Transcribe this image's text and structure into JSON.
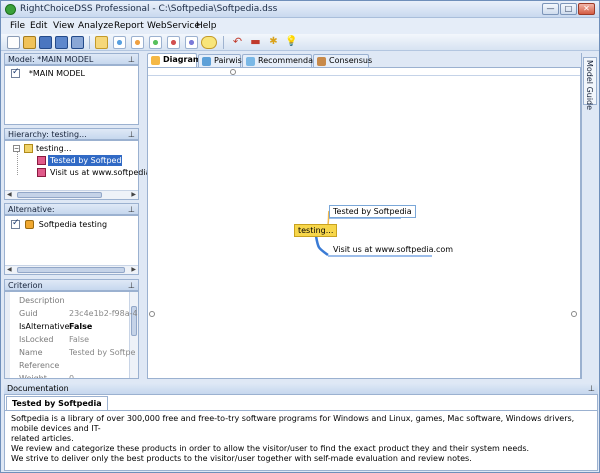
{
  "window": {
    "title": "RightChoiceDSS Professional - C:\\Softpedia\\Softpedia.dss",
    "min": "—",
    "max": "□",
    "close": "✕"
  },
  "menu": [
    "File",
    "Edit",
    "View",
    "Analyze",
    "Report",
    "WebService",
    "Help"
  ],
  "model": {
    "title": "Model: *MAIN MODEL",
    "items": [
      {
        "label": "*MAIN MODEL",
        "checked": true
      }
    ]
  },
  "hierarchy": {
    "title": "Hierarchy: testing...",
    "root": "testing...",
    "children": [
      "Tested by Softpedia",
      "Visit us at www.softpedia"
    ]
  },
  "alternative": {
    "title": "Alternative:",
    "items": [
      {
        "label": "Softpedia testing",
        "checked": true
      }
    ]
  },
  "criterion": {
    "title": "Criterion",
    "props": [
      {
        "key": "Description",
        "value": ""
      },
      {
        "key": "Guid",
        "value": "23c4e1b2-f98a-4"
      },
      {
        "key": "IsAlternative",
        "value": "False"
      },
      {
        "key": "IsLocked",
        "value": "False"
      },
      {
        "key": "Name",
        "value": "Tested by Softpe"
      },
      {
        "key": "Reference",
        "value": ""
      },
      {
        "key": "Weight",
        "value": "0"
      }
    ]
  },
  "tabs": [
    "Diagram",
    "Pairwise",
    "Recommendation",
    "Consensus"
  ],
  "side_tab": "Model Guide",
  "diagram": {
    "root": "testing...",
    "child1": "Tested by Softpedia",
    "child2": "Visit us at www.softpedia.com"
  },
  "documentation": {
    "title": "Documentation",
    "tab": "Tested by Softpedia",
    "lines": [
      "Softpedia is a library of over 300,000 free and free-to-try software programs for Windows and Linux, games, Mac software, Windows drivers, mobile devices and IT-",
      "related articles.",
      "We review and categorize these products in order to allow the visitor/user to find the exact product they and their system needs.",
      "We strive to deliver only the best products to the visitor/user together with self-made evaluation and review notes."
    ]
  },
  "pin_glyph": "⊥",
  "scroll_left": "◀",
  "scroll_right": "▶",
  "colors": {
    "accent": "#3163c4",
    "highlight": "#316ac5",
    "node_yellow": "#f7d64a"
  }
}
